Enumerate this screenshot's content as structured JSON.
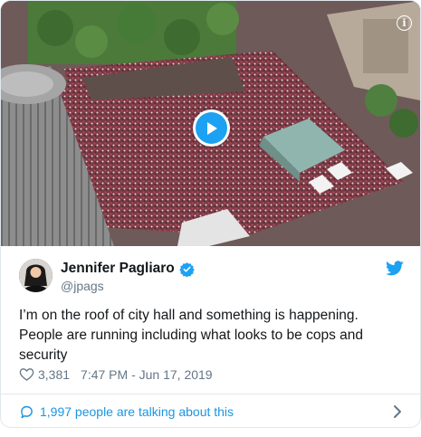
{
  "tweet": {
    "author": {
      "display_name": "Jennifer Pagliaro",
      "handle": "@jpags",
      "verified": true
    },
    "text": "I’m on the roof of city hall and something is happening. People are running including what looks to be cops and security",
    "likes": "3,381",
    "timestamp": "7:47 PM - Jun 17, 2019",
    "conversation_text": "1,997 people are talking about this",
    "media": {
      "type": "video",
      "overlay_icons": [
        "play-icon",
        "info-icon"
      ]
    }
  },
  "colors": {
    "brand_blue": "#1da1f2",
    "link_blue": "#1b95e0",
    "secondary_text": "#657786",
    "border": "#e1e8ed"
  },
  "icons": [
    "verified-icon",
    "twitter-bird-icon",
    "heart-icon",
    "speech-bubble-icon",
    "chevron-right-icon"
  ]
}
